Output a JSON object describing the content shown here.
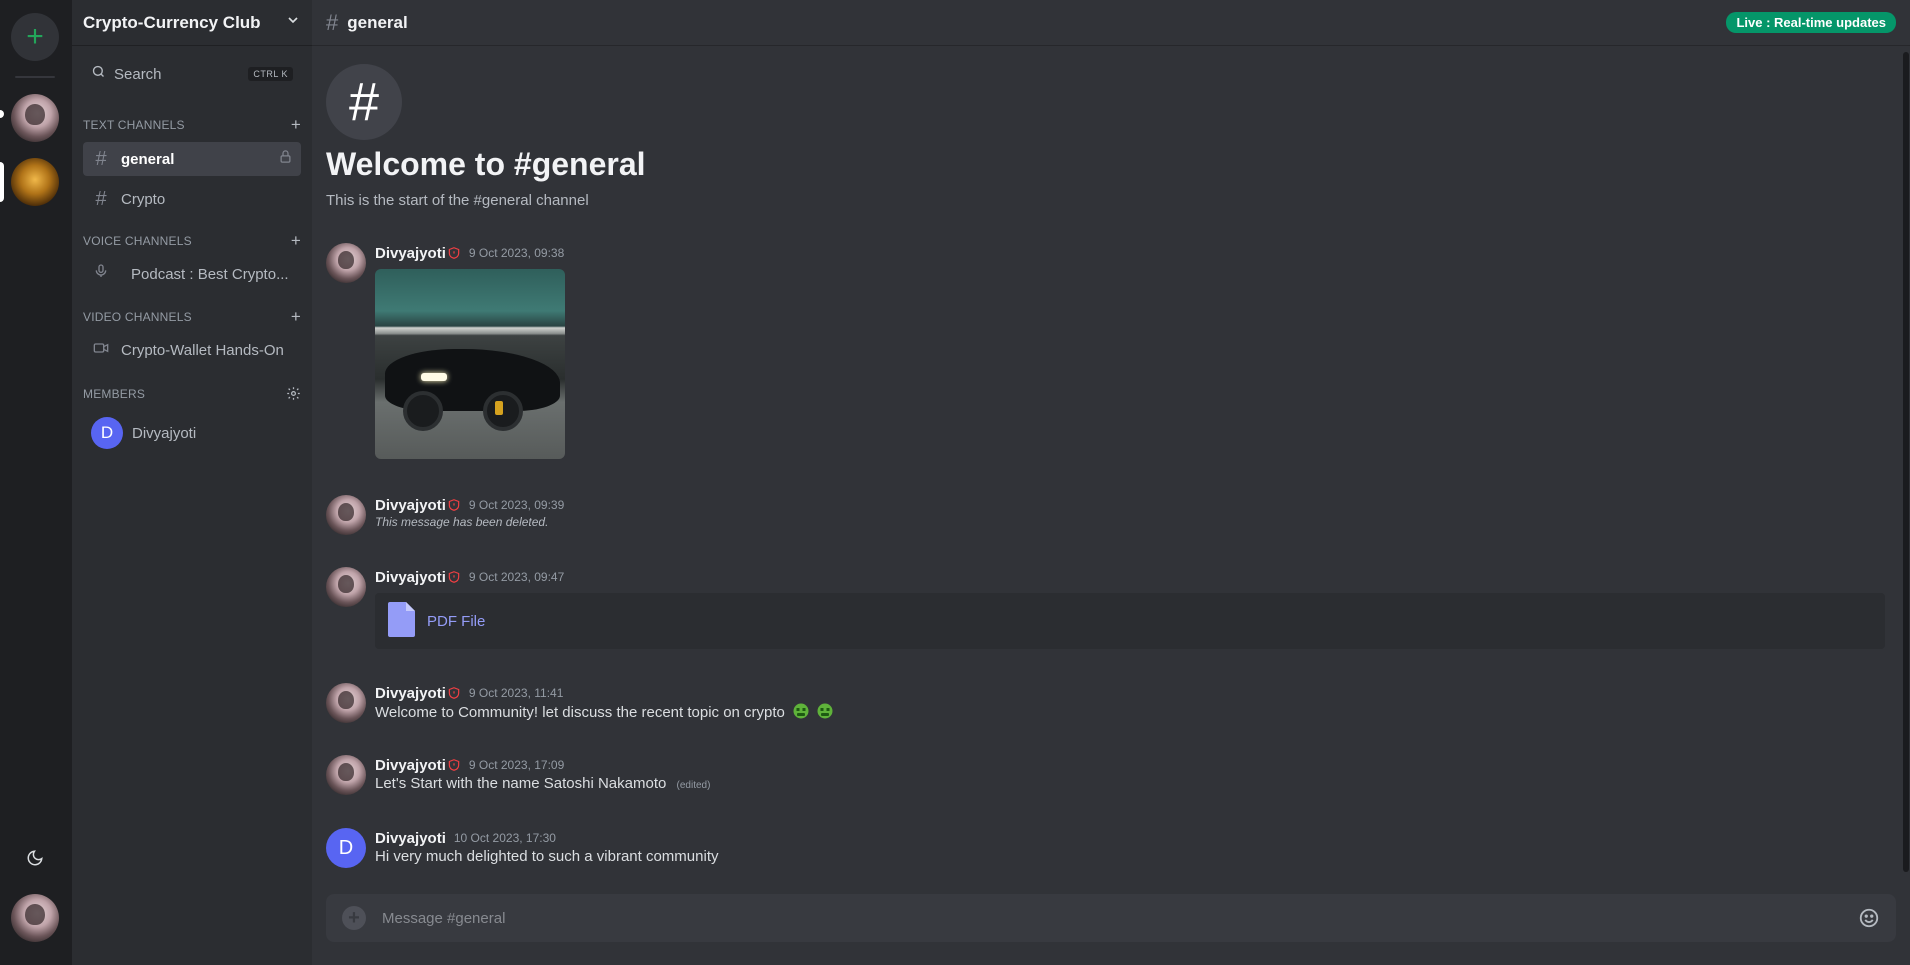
{
  "server": {
    "name": "Crypto-Currency Club"
  },
  "search": {
    "label": "Search",
    "shortcut": "CTRL K"
  },
  "sections": {
    "text": "TEXT CHANNELS",
    "voice": "VOICE CHANNELS",
    "video": "VIDEO CHANNELS",
    "members": "MEMBERS"
  },
  "channels": {
    "text": [
      {
        "label": "general",
        "icon": "hash-icon",
        "active": true,
        "locked": true
      },
      {
        "label": "Crypto",
        "icon": "hash-icon",
        "active": false
      }
    ],
    "voice": [
      {
        "label": "Podcast : Best Crypto...",
        "icon": "microphone-icon"
      }
    ],
    "video": [
      {
        "label": "Crypto-Wallet Hands-On",
        "icon": "video-camera-icon"
      }
    ]
  },
  "members": [
    {
      "name": "Divyajyoti",
      "initial": "D"
    }
  ],
  "topbar": {
    "channel": "general",
    "live_badge": "Live : Real-time updates"
  },
  "welcome": {
    "title": "Welcome to #general",
    "subtitle": "This is the start of the #general channel"
  },
  "messages": [
    {
      "author": "Divyajyoti",
      "time": "9 Oct 2023, 09:38",
      "type": "image"
    },
    {
      "author": "Divyajyoti",
      "time": "9 Oct 2023, 09:39",
      "text": "This message has been deleted.",
      "type": "deleted"
    },
    {
      "author": "Divyajyoti",
      "time": "9 Oct 2023, 09:47",
      "type": "file",
      "file_label": "PDF File"
    },
    {
      "author": "Divyajyoti",
      "time": "9 Oct 2023, 11:41",
      "text": "Welcome to Community! let discuss the recent topic on crypto",
      "type": "text"
    },
    {
      "author": "Divyajyoti",
      "time": "9 Oct 2023, 17:09",
      "text": "Let's Start with the name Satoshi Nakamoto",
      "edited": "(edited)",
      "type": "text"
    },
    {
      "author": "Divyajyoti",
      "time": "10 Oct 2023, 17:30",
      "text": "Hi very much delighted to such a vibrant community",
      "type": "text",
      "avatar_initial": "D"
    }
  ],
  "composer": {
    "placeholder": "Message #general"
  },
  "colors": {
    "accent": "#5865f2",
    "live": "#059669",
    "moderator_shield": "#f23f43",
    "link": "#949cf7"
  }
}
